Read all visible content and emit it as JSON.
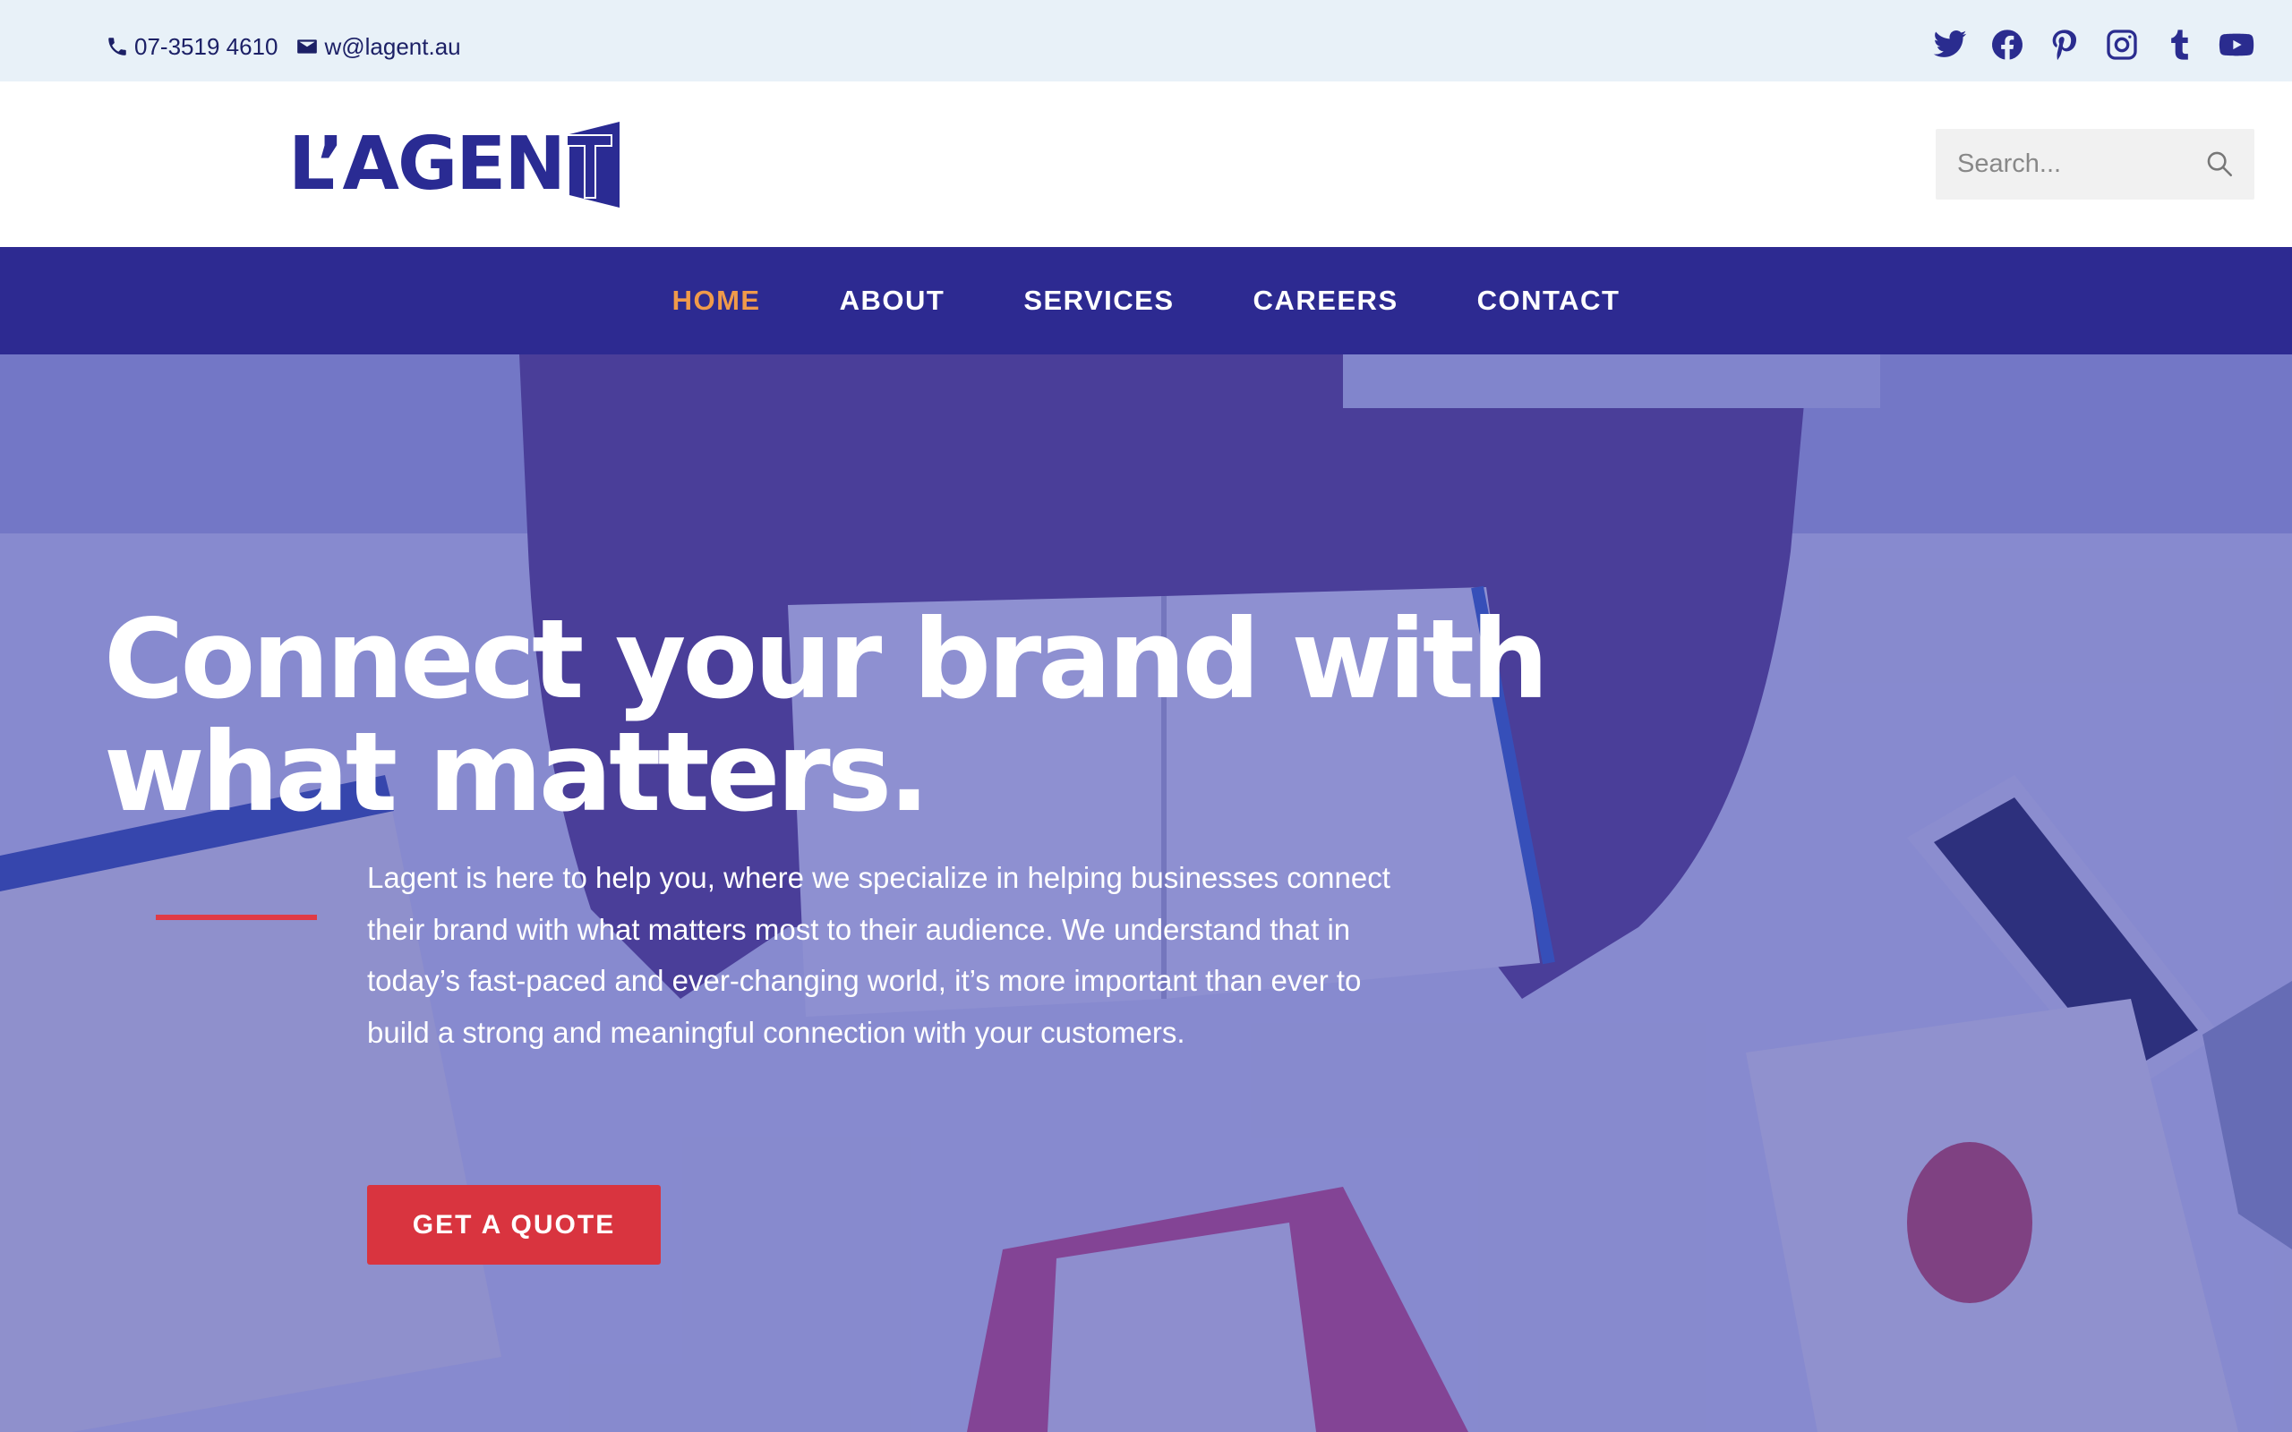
{
  "topbar": {
    "phone": "07-3519 4610",
    "email": "w@lagent.au",
    "social": [
      "twitter-icon",
      "facebook-icon",
      "pinterest-icon",
      "instagram-icon",
      "tumblr-icon",
      "youtube-icon"
    ]
  },
  "header": {
    "logo_text": "L’AGEN",
    "logo_last_letter": "T",
    "search_placeholder": "Search..."
  },
  "nav": {
    "items": [
      {
        "label": "HOME",
        "active": true
      },
      {
        "label": "ABOUT",
        "active": false
      },
      {
        "label": "SERVICES",
        "active": false
      },
      {
        "label": "CAREERS",
        "active": false
      },
      {
        "label": "CONTACT",
        "active": false
      }
    ]
  },
  "hero": {
    "headline": "Connect your brand with what matters.",
    "paragraph": "Lagent is here to help you, where we specialize in helping businesses connect their brand with what matters most to their audience. We understand that in today’s fast-paced and ever-changing world, it’s more important than ever to build a strong and meaningful connection with your customers.",
    "cta_label": "GET A QUOTE"
  },
  "colors": {
    "brand": "#2d2a91",
    "accent": "#f09a4a",
    "cta": "#d9343f",
    "topbar_bg": "#e8f1f8"
  }
}
